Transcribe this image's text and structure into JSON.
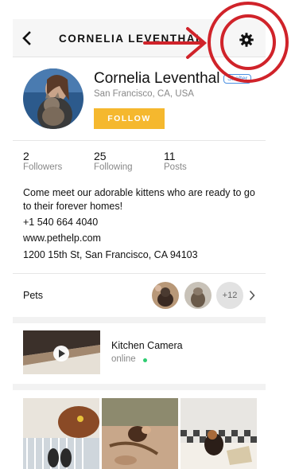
{
  "nav": {
    "title": "CORNELIA LEVENTHAL",
    "back_icon": "chevron-left-icon",
    "settings_icon": "gear-icon"
  },
  "profile": {
    "name": "Cornelia Leventhal",
    "badge": "Shelter",
    "location": "San Francisco, CA, USA",
    "follow_label": "FOLLOW"
  },
  "stats": [
    {
      "value": "2",
      "label": "Followers"
    },
    {
      "value": "25",
      "label": "Following"
    },
    {
      "value": "11",
      "label": "Posts"
    }
  ],
  "bio": {
    "description": "Come meet our adorable kittens who are ready to go to their forever homes!",
    "phone": "+1 540 664 4040",
    "website": "www.pethelp.com",
    "address": "1200 15th St, San Francisco, CA 94103"
  },
  "pets": {
    "label": "Pets",
    "more_count": "+12"
  },
  "camera": {
    "title": "Kitchen Camera",
    "status": "online"
  },
  "colors": {
    "accent": "#f5b82e",
    "badge": "#4a90e2",
    "online": "#2ecc71",
    "annotation": "#d0232a"
  }
}
